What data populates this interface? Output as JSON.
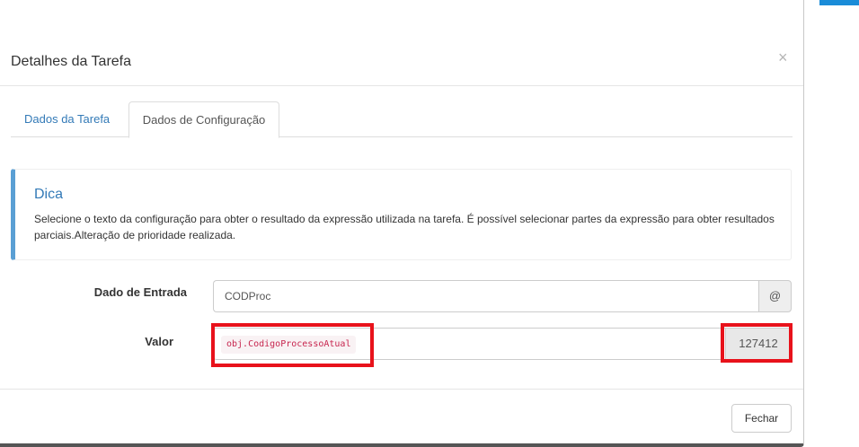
{
  "modal": {
    "title": "Detalhes da Tarefa",
    "close_glyph": "×"
  },
  "background": {
    "edge_glyph": "'",
    "accent_color": "#1a8cd8"
  },
  "tabs": [
    {
      "label": "Dados da Tarefa",
      "active": false
    },
    {
      "label": "Dados de Configuração",
      "active": true
    }
  ],
  "callout": {
    "title": "Dica",
    "text": "Selecione o texto da configuração para obter o resultado da expressão utilizada na tarefa. É possível selecionar partes da expressão para obter resultados parciais.Alteração de prioridade realizada."
  },
  "form": {
    "entrada": {
      "label": "Dado de Entrada",
      "value": "CODProc",
      "addon": "@"
    },
    "valor": {
      "label": "Valor",
      "expression": "obj.CodigoProcessoAtual",
      "result": "127412"
    }
  },
  "footer": {
    "close_label": "Fechar"
  },
  "colors": {
    "link": "#337ab7",
    "callout_border": "#5a9fd4",
    "highlight": "#e8121b",
    "code_text": "#c7254e"
  }
}
